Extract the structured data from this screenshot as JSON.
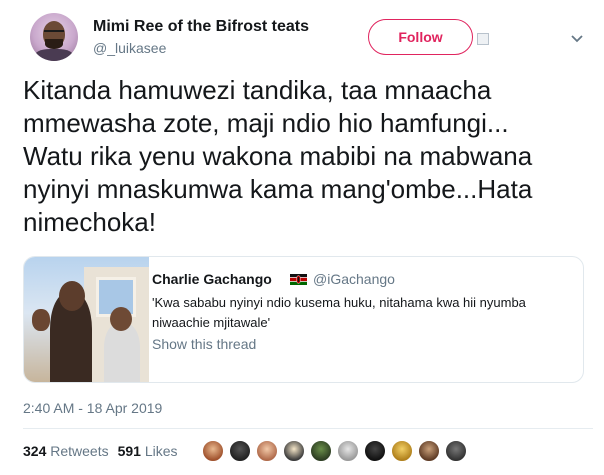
{
  "author": {
    "display_name": "Mimi Ree of the Bifrost teats",
    "handle": "@_luikasee",
    "avatar_icon": "avatar"
  },
  "follow_button": {
    "label": "Follow",
    "color": "#e0245e"
  },
  "tweet": {
    "lines": [
      "Kitanda hamuwezi tandika, taa mnaacha",
      "mmewasha zote, maji ndio hio hamfungi...",
      "Watu rika yenu wakona mabibi na mabwana",
      "nyinyi mnaskumwa kama mang'ombe...Hata",
      "nimechoka!"
    ],
    "timestamp": "2:40 AM - 18 Apr 2019"
  },
  "quoted_tweet": {
    "display_name": "Charlie Gachango",
    "flag_icon": "kenya-flag-icon",
    "handle": "@iGachango",
    "text_lines": [
      "'Kwa sababu nyinyi ndio kusema huku, nitahama kwa hii nyumba",
      "niwaachie mjitawale'"
    ],
    "show_thread": "Show this thread"
  },
  "stats": {
    "retweets_count": "324",
    "retweets_label": "Retweets",
    "likes_count": "591",
    "likes_label": "Likes"
  },
  "colors": {
    "text": "#14171a",
    "secondary": "#657786",
    "border": "#e1e8ed",
    "accent": "#e0245e"
  }
}
